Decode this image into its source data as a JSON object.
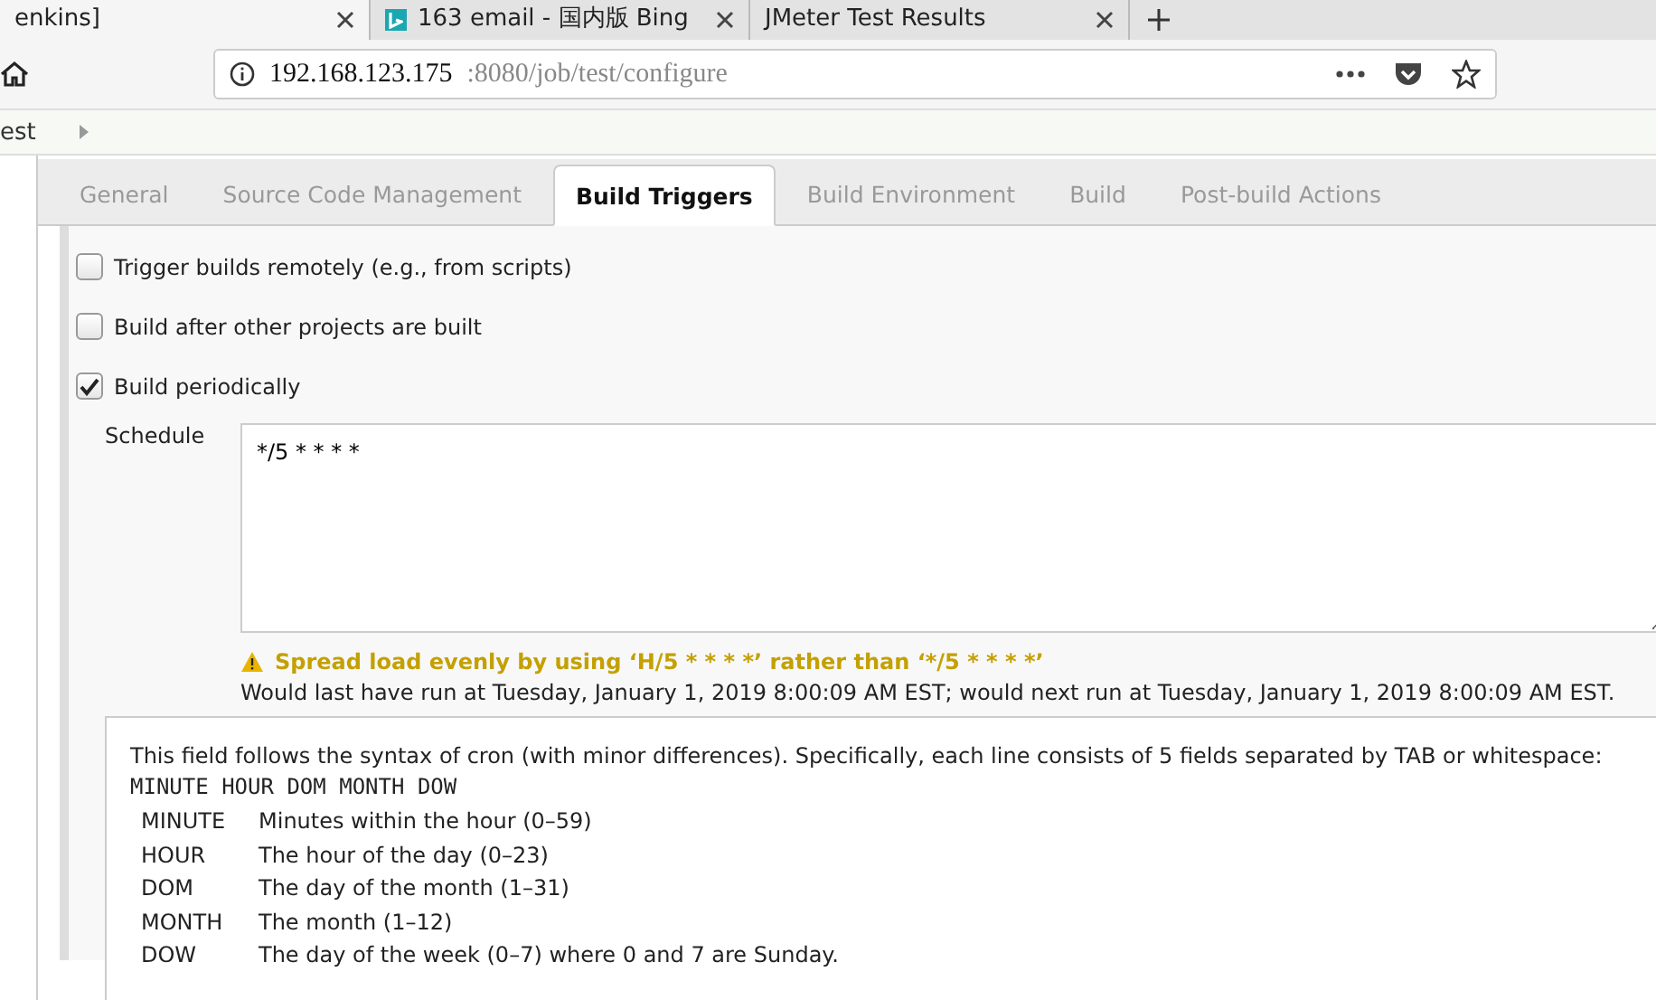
{
  "browser_tabs": [
    {
      "title": "enkins]",
      "selected": true,
      "kind": "plain"
    },
    {
      "title": "163 email - 国内版 Bing",
      "selected": false,
      "kind": "bing"
    },
    {
      "title": "JMeter Test Results",
      "selected": false,
      "kind": "plain"
    }
  ],
  "address_bar": {
    "host": "192.168.123.175",
    "path": ":8080/job/test/configure"
  },
  "breadcrumb": "est",
  "tabs": [
    {
      "label": "General",
      "selected": false
    },
    {
      "label": "Source Code Management",
      "selected": false
    },
    {
      "label": "Build Triggers",
      "selected": true
    },
    {
      "label": "Build Environment",
      "selected": false
    },
    {
      "label": "Build",
      "selected": false
    },
    {
      "label": "Post-build Actions",
      "selected": false
    }
  ],
  "triggers": [
    {
      "label": "Trigger builds remotely (e.g., from scripts)",
      "checked": false
    },
    {
      "label": "Build after other projects are built",
      "checked": false
    },
    {
      "label": "Build periodically",
      "checked": true
    }
  ],
  "schedule": {
    "label": "Schedule",
    "value": "*/5 * * * *",
    "warning": "Spread load evenly by using ‘H/5 * * * *’ rather than ‘*/5 * * * *’",
    "info": "Would last have run at Tuesday, January 1, 2019 8:00:09 AM EST; would next run at Tuesday, January 1, 2019 8:00:09 AM EST."
  },
  "help": {
    "intro": "This field follows the syntax of cron (with minor differences). Specifically, each line consists of 5 fields separated by TAB or whitespace:",
    "format": "MINUTE HOUR DOM MONTH DOW",
    "fields": [
      {
        "name": "MINUTE",
        "description": "Minutes within the hour (0–59)"
      },
      {
        "name": "HOUR",
        "description": "The hour of the day (0–23)"
      },
      {
        "name": "DOM",
        "description": "The day of the month (1–31)"
      },
      {
        "name": "MONTH",
        "description": "The month (1–12)"
      },
      {
        "name": "DOW",
        "description": "The day of the week (0–7) where 0 and 7 are Sunday."
      }
    ]
  }
}
